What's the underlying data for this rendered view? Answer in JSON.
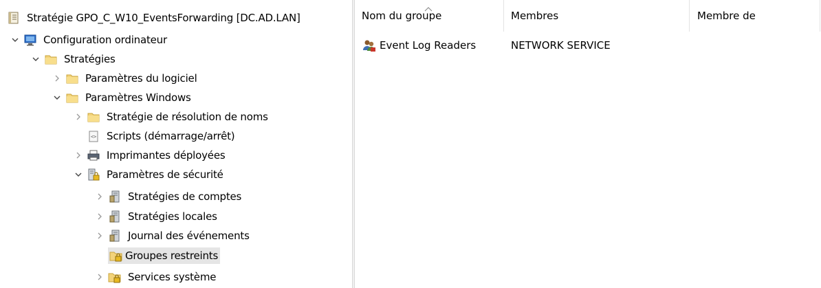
{
  "tree": {
    "root": {
      "label": "Stratégie GPO_C_W10_EventsForwarding [DC.AD.LAN]",
      "icon": "policy-document-icon"
    },
    "items": [
      {
        "label": "Configuration ordinateur",
        "icon": "computer-config-icon",
        "expanded": true
      },
      {
        "label": "Stratégies",
        "icon": "folder-icon",
        "expanded": true
      },
      {
        "label": "Paramètres du logiciel",
        "icon": "folder-icon",
        "expanded": false
      },
      {
        "label": "Paramètres Windows",
        "icon": "folder-icon",
        "expanded": true
      },
      {
        "label": "Stratégie de résolution de noms",
        "icon": "folder-icon",
        "expanded": false
      },
      {
        "label": "Scripts (démarrage/arrêt)",
        "icon": "script-icon",
        "expanded": null
      },
      {
        "label": "Imprimantes déployées",
        "icon": "printer-icon",
        "expanded": false
      },
      {
        "label": "Paramètres de sécurité",
        "icon": "security-settings-icon",
        "expanded": true
      },
      {
        "label": "Stratégies de comptes",
        "icon": "server-policy-icon",
        "expanded": false
      },
      {
        "label": "Stratégies locales",
        "icon": "server-policy-icon",
        "expanded": false
      },
      {
        "label": "Journal des événements",
        "icon": "server-policy-icon",
        "expanded": false
      },
      {
        "label": "Groupes restreints",
        "icon": "locked-folder-icon",
        "expanded": null,
        "selected": true
      },
      {
        "label": "Services système",
        "icon": "locked-folder-icon",
        "expanded": false
      }
    ]
  },
  "list": {
    "columns": [
      "Nom du groupe",
      "Membres",
      "Membre de"
    ],
    "rows": [
      {
        "name": "Event Log Readers",
        "members": "NETWORK SERVICE",
        "member_of": "",
        "icon": "group-icon"
      }
    ]
  }
}
